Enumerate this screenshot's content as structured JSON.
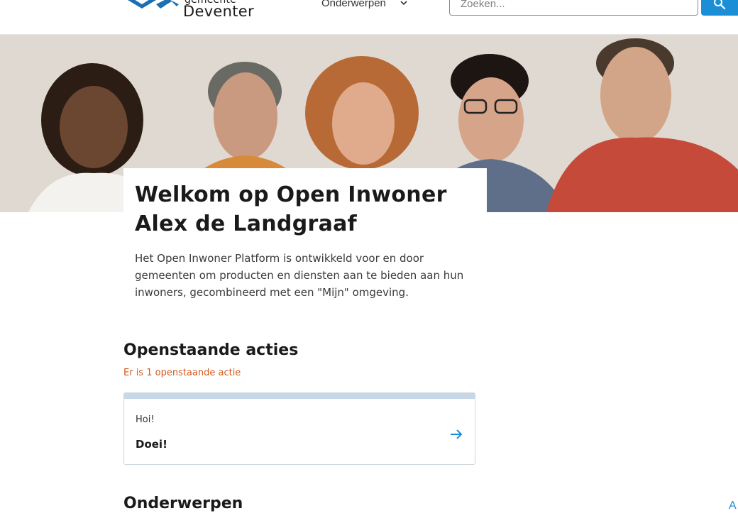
{
  "header": {
    "logo": {
      "line1": "gemeente",
      "line2": "Deventer"
    },
    "nav": {
      "label": "Onderwerpen"
    },
    "search": {
      "placeholder": "Zoeken..."
    }
  },
  "hero": {
    "title": "Welkom op Open Inwoner Alex de Landgraaf",
    "intro": "Het Open Inwoner Platform is ontwikkeld voor en door gemeenten om producten en diensten aan te bieden aan hun inwoners, gecombineerd met een \"Mijn\" omgeving."
  },
  "actions": {
    "title": "Openstaande acties",
    "subtitle": "Er is 1 openstaande actie",
    "card": {
      "label": "Hoi!",
      "title": "Doei!"
    }
  },
  "topics": {
    "title": "Onderwerpen"
  },
  "corner": {
    "label": "A"
  },
  "colors": {
    "accent": "#1a8fd6",
    "action_orange": "#d4591e",
    "card_top": "#c6d8e8"
  }
}
